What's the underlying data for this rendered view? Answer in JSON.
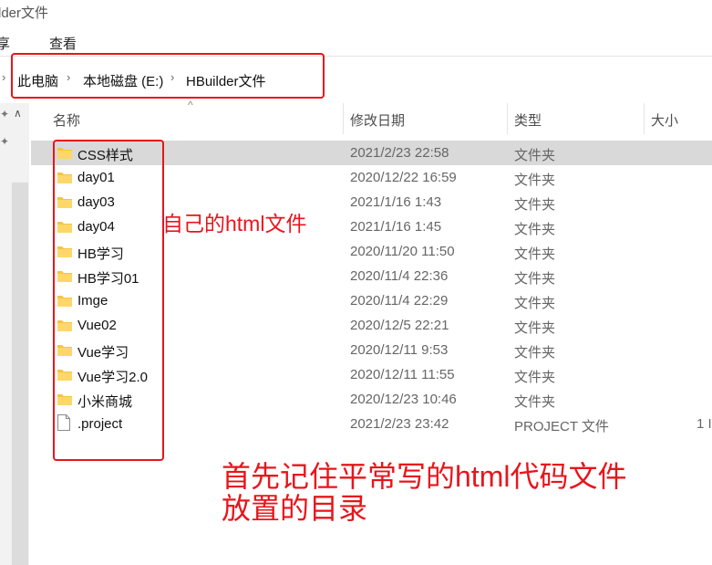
{
  "window": {
    "title_fragment": "lder文件"
  },
  "ribbon": {
    "share_fragment": "享",
    "view": "查看"
  },
  "address": {
    "crumbs": [
      "此电脑",
      "本地磁盘 (E:)",
      "HBuilder文件"
    ],
    "separator": "›"
  },
  "columns": {
    "name": "名称",
    "date": "修改日期",
    "type": "类型",
    "size": "大小"
  },
  "files": [
    {
      "name": "CSS样式",
      "date": "2021/2/23 22:58",
      "type": "文件夹",
      "size": "",
      "icon": "folder-icon",
      "selected": true
    },
    {
      "name": "day01",
      "date": "2020/12/22 16:59",
      "type": "文件夹",
      "size": "",
      "icon": "folder-icon"
    },
    {
      "name": "day03",
      "date": "2021/1/16 1:43",
      "type": "文件夹",
      "size": "",
      "icon": "folder-icon"
    },
    {
      "name": "day04",
      "date": "2021/1/16 1:45",
      "type": "文件夹",
      "size": "",
      "icon": "folder-icon"
    },
    {
      "name": "HB学习",
      "date": "2020/11/20 11:50",
      "type": "文件夹",
      "size": "",
      "icon": "folder-icon"
    },
    {
      "name": "HB学习01",
      "date": "2020/11/4 22:36",
      "type": "文件夹",
      "size": "",
      "icon": "folder-icon"
    },
    {
      "name": "Imge",
      "date": "2020/11/4 22:29",
      "type": "文件夹",
      "size": "",
      "icon": "folder-icon"
    },
    {
      "name": "Vue02",
      "date": "2020/12/5 22:21",
      "type": "文件夹",
      "size": "",
      "icon": "folder-icon"
    },
    {
      "name": "Vue学习",
      "date": "2020/12/11 9:53",
      "type": "文件夹",
      "size": "",
      "icon": "folder-icon"
    },
    {
      "name": "Vue学习2.0",
      "date": "2020/12/11 11:55",
      "type": "文件夹",
      "size": "",
      "icon": "folder-icon"
    },
    {
      "name": "小米商城",
      "date": "2020/12/23 10:46",
      "type": "文件夹",
      "size": "",
      "icon": "folder-icon"
    },
    {
      "name": ".project",
      "date": "2021/2/23 23:42",
      "type": "PROJECT 文件",
      "size": "1 I",
      "icon": "file-icon"
    }
  ],
  "annotations": {
    "note1": "自己的html文件",
    "note2_line1": "首先记住平常写的html代码文件",
    "note2_line2": "放置的目录"
  },
  "colors": {
    "annotation_red": "#e8151b",
    "folder_yellow": "#f6c443",
    "selected_row": "#d9d9d9"
  }
}
